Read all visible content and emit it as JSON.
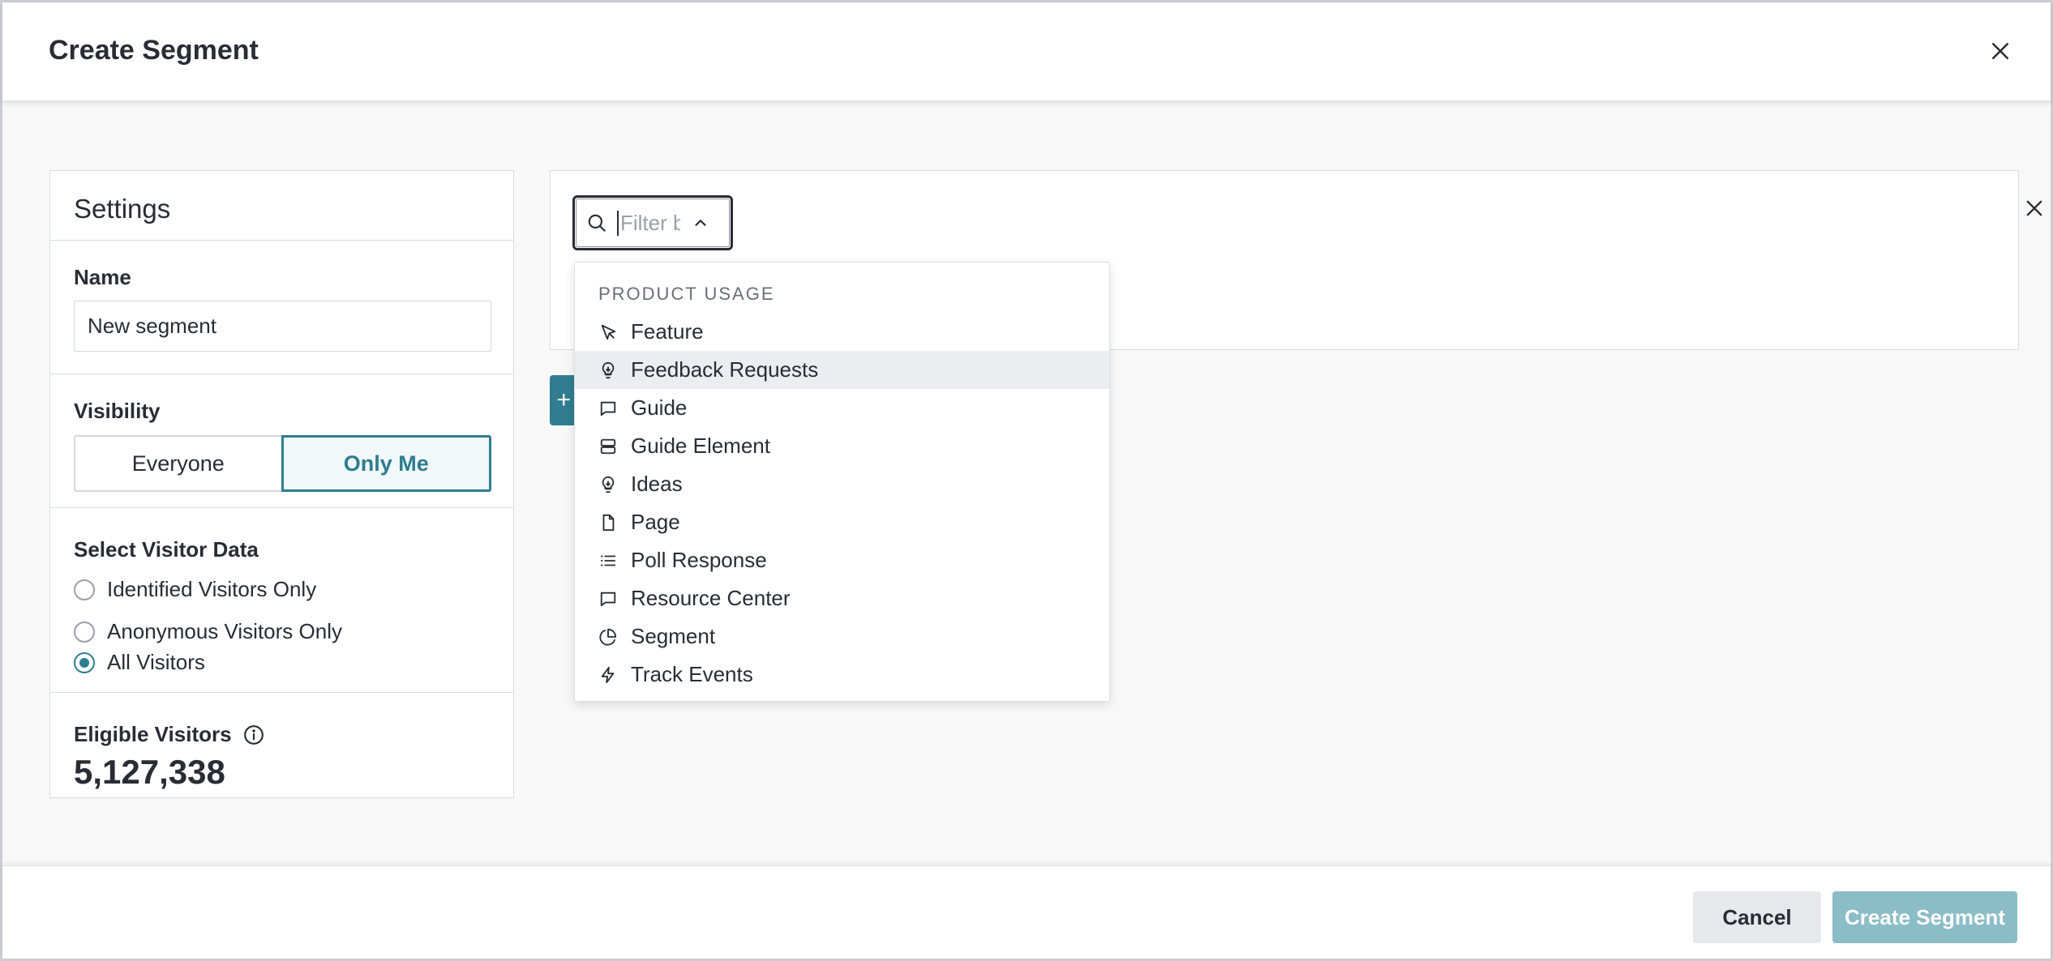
{
  "header": {
    "title": "Create Segment"
  },
  "settings": {
    "title": "Settings",
    "name_label": "Name",
    "name_value": "New segment",
    "visibility_label": "Visibility",
    "visibility_options": [
      "Everyone",
      "Only Me"
    ],
    "visibility_selected": "Only Me",
    "visitor_data_label": "Select Visitor Data",
    "visitor_options": [
      "Identified Visitors Only",
      "Anonymous Visitors Only",
      "All Visitors"
    ],
    "visitor_selected": "All Visitors",
    "eligible_label": "Eligible Visitors",
    "eligible_count": "5,127,338"
  },
  "filter": {
    "placeholder": "Filter by",
    "add_button_label": "+"
  },
  "dropdown": {
    "section_header": "PRODUCT USAGE",
    "items": [
      {
        "label": "Feature",
        "icon": "cursor-arrow-icon"
      },
      {
        "label": "Feedback Requests",
        "icon": "lightbulb-icon"
      },
      {
        "label": "Guide",
        "icon": "message-square-icon"
      },
      {
        "label": "Guide Element",
        "icon": "layout-rows-icon"
      },
      {
        "label": "Ideas",
        "icon": "lightbulb-icon"
      },
      {
        "label": "Page",
        "icon": "file-icon"
      },
      {
        "label": "Poll Response",
        "icon": "list-icon"
      },
      {
        "label": "Resource Center",
        "icon": "message-square-icon"
      },
      {
        "label": "Segment",
        "icon": "pie-chart-icon"
      },
      {
        "label": "Track Events",
        "icon": "lightning-bolt-icon"
      }
    ],
    "highlighted": "Feedback Requests"
  },
  "footer": {
    "cancel_label": "Cancel",
    "create_label": "Create Segment"
  },
  "colors": {
    "accent": "#2f7d8f",
    "create_disabled": "#8bbdc7"
  }
}
